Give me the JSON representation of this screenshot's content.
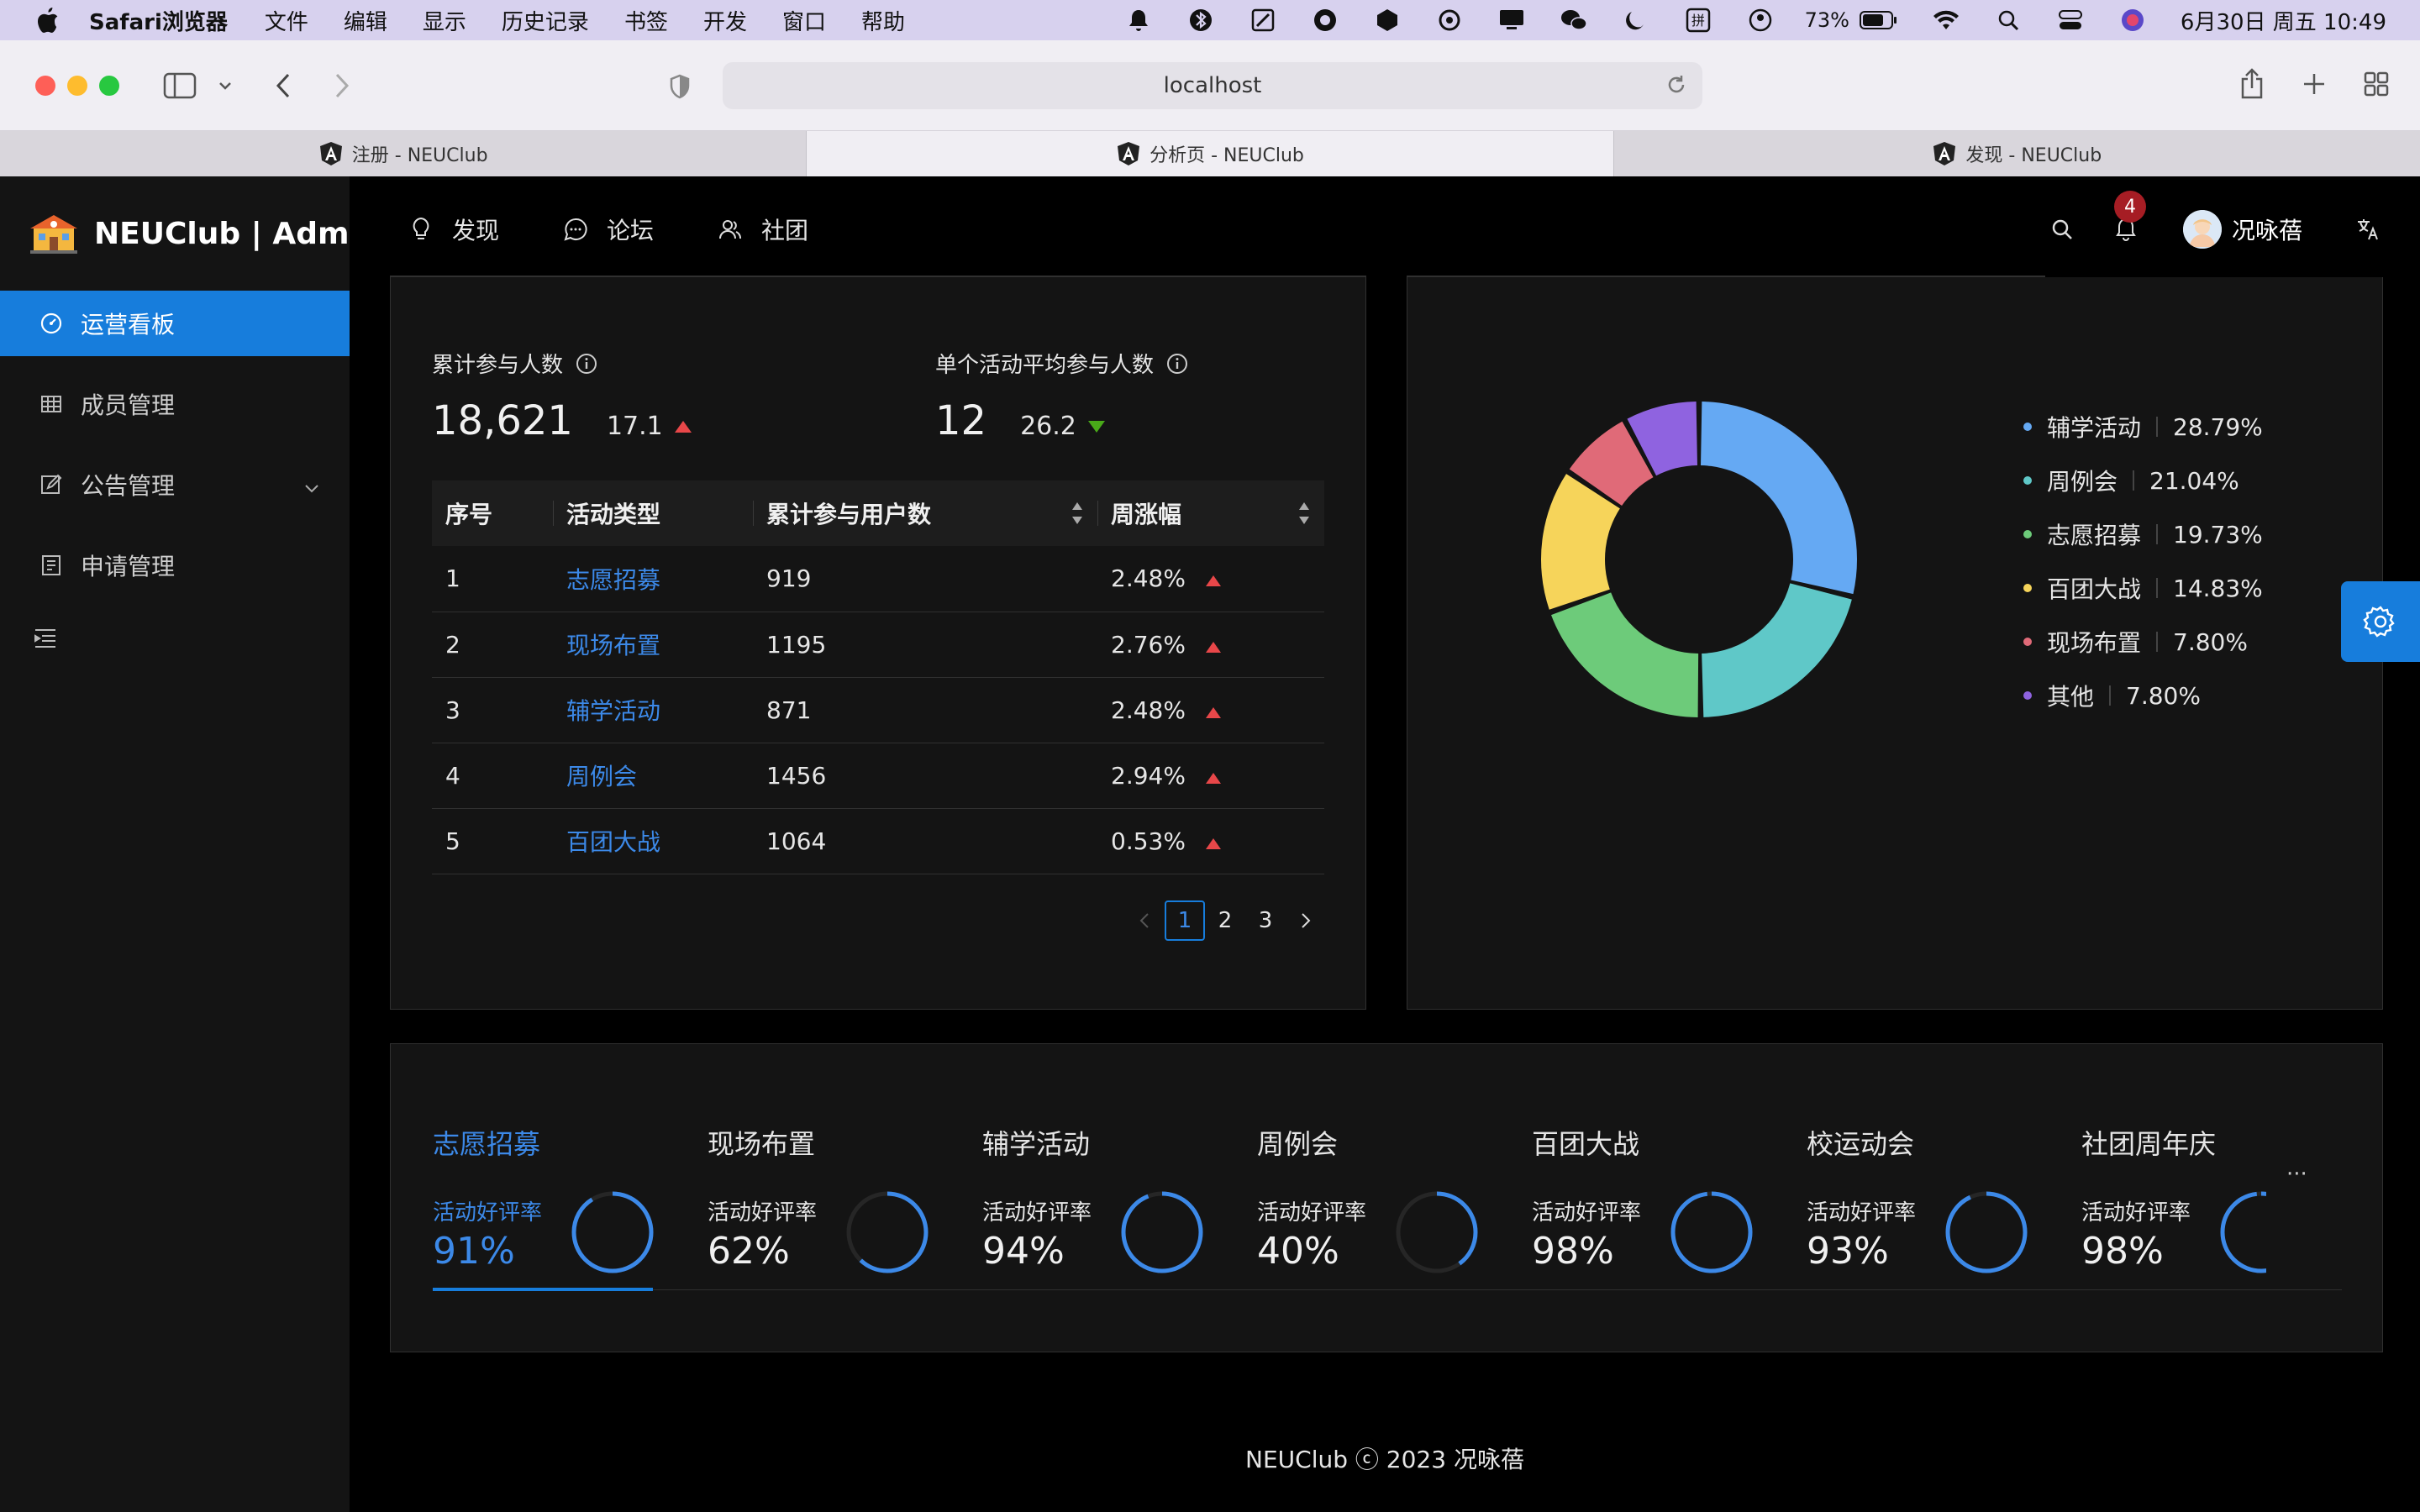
{
  "menubar": {
    "app_name": "Safari浏览器",
    "menus": [
      "文件",
      "编辑",
      "显示",
      "历史记录",
      "书签",
      "开发",
      "窗口",
      "帮助"
    ],
    "battery": "73%",
    "clock": "6月30日 周五 10:49",
    "tray_icons": [
      "bell-icon",
      "bluetooth-icon",
      "edit-icon",
      "globe-icon",
      "paw-icon",
      "sync-icon",
      "display-icon",
      "wechat-icon",
      "moon-icon",
      "input-method-icon",
      "user-icon",
      "battery-icon",
      "wifi-icon",
      "search-icon",
      "control-center-icon",
      "siri-icon"
    ]
  },
  "browser": {
    "address": "localhost",
    "tabs": [
      {
        "label": "注册 - NEUClub",
        "active": false
      },
      {
        "label": "分析页 - NEUClub",
        "active": true
      },
      {
        "label": "发现 - NEUClub",
        "active": false
      }
    ]
  },
  "sidebar": {
    "brand": "NEUClub | Adm",
    "items": [
      {
        "label": "运营看板",
        "icon": "dashboard-icon",
        "active": true
      },
      {
        "label": "成员管理",
        "icon": "table-icon",
        "active": false
      },
      {
        "label": "公告管理",
        "icon": "form-icon",
        "active": false
      },
      {
        "label": "申请管理",
        "icon": "profile-icon",
        "active": false
      }
    ]
  },
  "header": {
    "menu": [
      {
        "label": "发现",
        "icon": "bulb-icon"
      },
      {
        "label": "论坛",
        "icon": "message-icon"
      },
      {
        "label": "社团",
        "icon": "team-icon"
      }
    ],
    "notification_count": "4",
    "username": "况咏蓓"
  },
  "stats": {
    "total_label": "累计参与人数",
    "total_value": "18,621",
    "total_change": "17.1",
    "avg_label": "单个活动平均参与人数",
    "avg_value": "12",
    "avg_change": "26.2"
  },
  "table": {
    "columns": [
      "序号",
      "活动类型",
      "累计参与用户数",
      "周涨幅"
    ],
    "rows": [
      {
        "index": "1",
        "type": "志愿招募",
        "users": "919",
        "growth": "2.48%"
      },
      {
        "index": "2",
        "type": "现场布置",
        "users": "1195",
        "growth": "2.76%"
      },
      {
        "index": "3",
        "type": "辅学活动",
        "users": "871",
        "growth": "2.48%"
      },
      {
        "index": "4",
        "type": "周例会",
        "users": "1456",
        "growth": "2.94%"
      },
      {
        "index": "5",
        "type": "百团大战",
        "users": "1064",
        "growth": "0.53%"
      }
    ],
    "pages": [
      "1",
      "2",
      "3"
    ],
    "current_page": "1"
  },
  "chart_data": {
    "type": "pie",
    "donut": true,
    "categories": [
      "辅学活动",
      "周例会",
      "志愿招募",
      "百团大战",
      "现场布置",
      "其他"
    ],
    "values": [
      28.79,
      21.04,
      19.73,
      14.83,
      7.8,
      7.8
    ],
    "labels": [
      "28.79%",
      "21.04%",
      "19.73%",
      "14.83%",
      "7.80%",
      "7.80%"
    ],
    "colors": [
      "#65a9f3",
      "#5fc8c8",
      "#6dcb7a",
      "#f6d45a",
      "#e06a78",
      "#8f63e0"
    ],
    "legend": "right"
  },
  "rates": {
    "label": "活动好评率",
    "items": [
      {
        "title": "志愿招募",
        "value": "91%",
        "percent": 91,
        "active": true
      },
      {
        "title": "现场布置",
        "value": "62%",
        "percent": 62,
        "active": false
      },
      {
        "title": "辅学活动",
        "value": "94%",
        "percent": 94,
        "active": false
      },
      {
        "title": "周例会",
        "value": "40%",
        "percent": 40,
        "active": false
      },
      {
        "title": "百团大战",
        "value": "98%",
        "percent": 98,
        "active": false
      },
      {
        "title": "校运动会",
        "value": "93%",
        "percent": 93,
        "active": false
      },
      {
        "title": "社团周年庆",
        "value": "98%",
        "percent": 98,
        "active": false
      }
    ],
    "more": "···"
  },
  "footer": "NEUClub ⓒ 2023 况咏蓓"
}
